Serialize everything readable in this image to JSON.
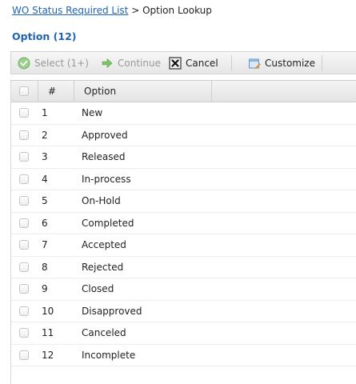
{
  "breadcrumb": {
    "link": "WO Status Required List",
    "separator": " > ",
    "current": "Option Lookup"
  },
  "section": {
    "title": "Option (12)"
  },
  "toolbar": {
    "select_label": "Select (1+)",
    "continue_label": "Continue",
    "cancel_label": "Cancel",
    "customize_label": "Customize"
  },
  "grid": {
    "headers": {
      "number": "#",
      "option": "Option"
    },
    "rows": [
      {
        "num": "1",
        "option": "New"
      },
      {
        "num": "2",
        "option": "Approved"
      },
      {
        "num": "3",
        "option": "Released"
      },
      {
        "num": "4",
        "option": "In-process"
      },
      {
        "num": "5",
        "option": "On-Hold"
      },
      {
        "num": "6",
        "option": "Completed"
      },
      {
        "num": "7",
        "option": "Accepted"
      },
      {
        "num": "8",
        "option": "Rejected"
      },
      {
        "num": "9",
        "option": "Closed"
      },
      {
        "num": "10",
        "option": "Disapproved"
      },
      {
        "num": "11",
        "option": "Canceled"
      },
      {
        "num": "12",
        "option": "Incomplete"
      }
    ]
  },
  "colors": {
    "link": "#1f63b5",
    "select_icon": "#5cb85c",
    "continue_icon": "#4cae4c"
  },
  "icons": {
    "select": "check-circle-icon",
    "continue": "arrow-right-icon",
    "cancel": "close-box-icon",
    "customize": "customize-icon"
  }
}
